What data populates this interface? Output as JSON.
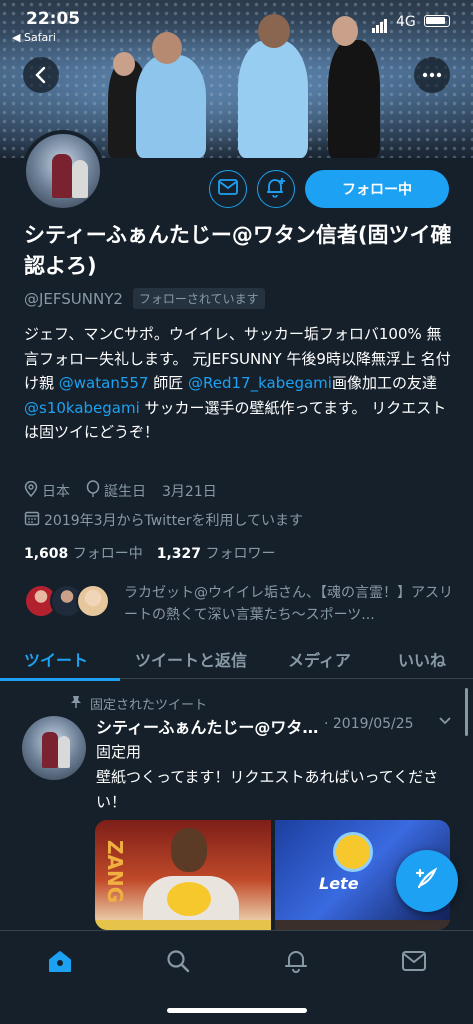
{
  "status_bar": {
    "time": "22:05",
    "back_app": "◀ Safari",
    "network": "4G"
  },
  "profile": {
    "display_name": "シティーふぁんたじー@ワタン信者(固ツイ確認よろ)",
    "handle": "@JEFSUNNY2",
    "follows_you": "フォローされています",
    "follow_button": "フォロー中",
    "bio_1": "ジェフ、マンCサポ。ウイイレ、サッカー垢フォロバ100% 無言フォロー失礼します。 元JEFSUNNY 午後9時以降無浮上 名付け親 ",
    "bio_link_1": "@watan557",
    "bio_2": " 師匠 ",
    "bio_link_2": "@Red17_kabegami",
    "bio_3": "画像加工の友達 ",
    "bio_link_3": "@s10kabegami",
    "bio_4": " サッカー選手の壁紙作ってます。 リクエストは固ツイにどうぞ！",
    "location": "日本",
    "birthday_label": "誕生日",
    "birthday": "3月21日",
    "joined": "2019年3月からTwitterを利用しています",
    "following_count": "1,608",
    "following_label": "フォロー中",
    "followers_count": "1,327",
    "followers_label": "フォロワー",
    "followed_by_text": "ラカゼット@ウイイレ垢さん、【魂の言霊！】アスリートの熱くて深い言葉たち〜スポーツ..."
  },
  "tabs": [
    {
      "label": "ツイート",
      "active": true
    },
    {
      "label": "ツイートと返信",
      "active": false
    },
    {
      "label": "メディア",
      "active": false
    },
    {
      "label": "いいね",
      "active": false
    }
  ],
  "tweet": {
    "pinned_label": "固定されたツイート",
    "author": "シティーふぁんたじー@ワタン信者(固ツイ確認よろ)",
    "date": "· 2019/05/25",
    "line_1": "固定用",
    "line_2": "壁紙つくってます！リクエストあればいってください！",
    "media_1_text": "ZANG",
    "media_2_text": "Lete"
  },
  "icons": {
    "back": "back-arrow-icon",
    "more": "more-icon",
    "mail": "mail-icon",
    "notify": "bell-plus-icon",
    "location": "location-pin-icon",
    "birthday": "balloon-icon",
    "calendar": "calendar-icon",
    "pin": "pin-icon",
    "compose": "compose-icon",
    "home": "home-icon",
    "search": "search-icon",
    "notifications": "bell-icon",
    "messages": "mail-icon"
  },
  "colors": {
    "background": "#15202b",
    "accent": "#1da1f2",
    "secondary_text": "#8899a6"
  }
}
